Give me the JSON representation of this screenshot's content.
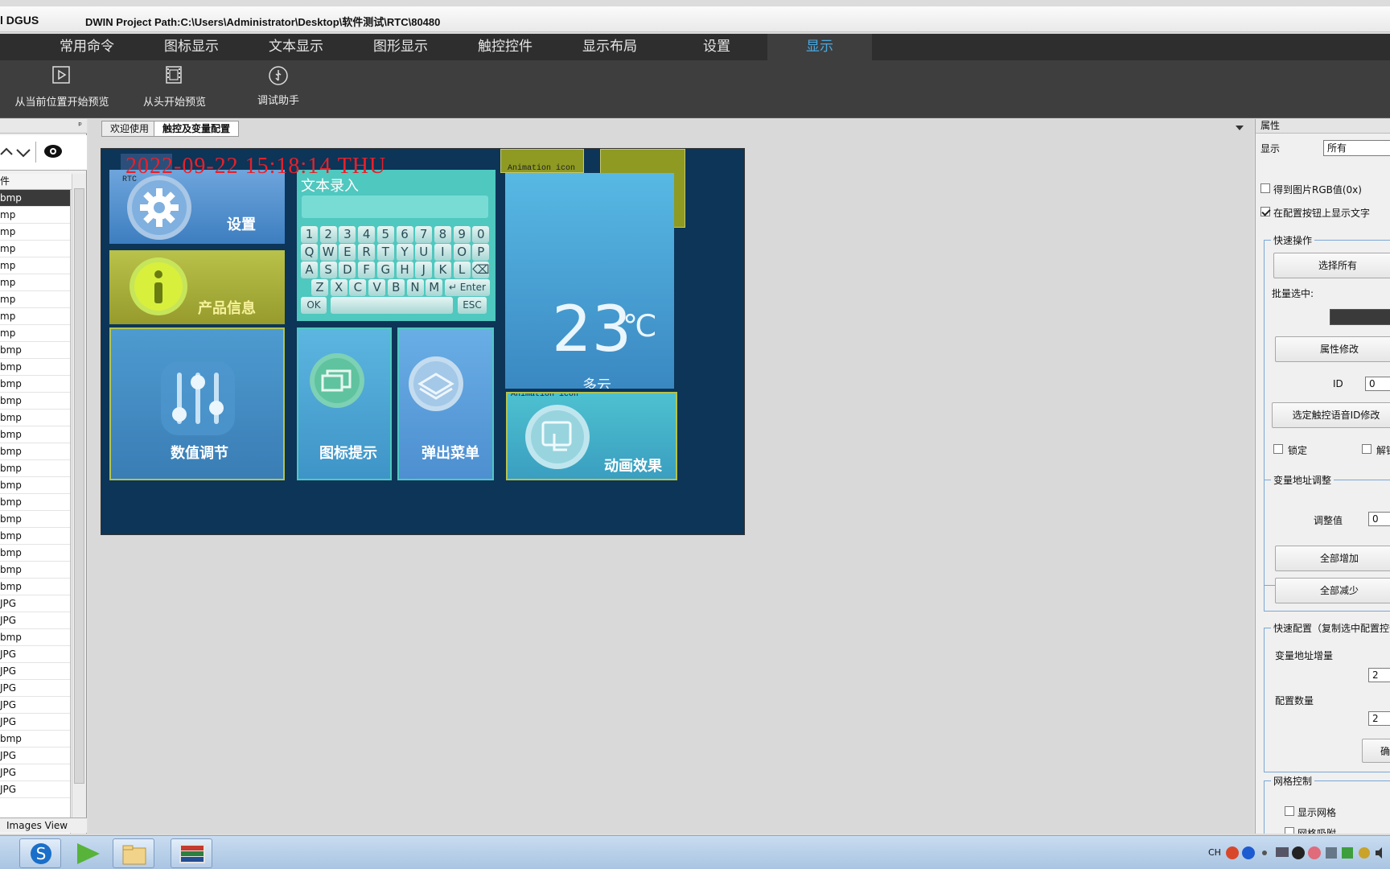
{
  "titlebar": {
    "app": "l DGUS",
    "path": "DWIN Project Path:C:\\Users\\Administrator\\Desktop\\软件测试\\RTC\\80480"
  },
  "menu": {
    "items": [
      "常用命令",
      "图标显示",
      "文本显示",
      "图形显示",
      "触控控件",
      "显示布局",
      "设置",
      "显示"
    ],
    "active": "显示"
  },
  "ribbon": {
    "buttons": [
      "从当前位置开始预览",
      "从头开始预览",
      "调试助手"
    ]
  },
  "left_panel": {
    "pin_glyph": "ᵖ",
    "column_header": "件",
    "files": [
      "bmp",
      "mp",
      "mp",
      "mp",
      "mp",
      "mp",
      "mp",
      "mp",
      "mp",
      "bmp",
      "bmp",
      "bmp",
      "bmp",
      "bmp",
      "bmp",
      "bmp",
      "bmp",
      "bmp",
      "bmp",
      "bmp",
      "bmp",
      "bmp",
      "bmp",
      "bmp",
      "JPG",
      "JPG",
      "bmp",
      "JPG",
      "JPG",
      "JPG",
      "JPG",
      "JPG",
      "bmp",
      "JPG",
      "JPG",
      "JPG"
    ],
    "bottom_tab": "Images View"
  },
  "tabs": [
    "欢迎使用",
    "触控及变量配置"
  ],
  "active_tab": "触控及变量配置",
  "screen": {
    "datetime": "2022-09-22 15:18:14 THU",
    "rtc_label": "RTC",
    "settings_label": "设置",
    "product_info_label": "产品信息",
    "value_adjust_label": "数值调节",
    "icon_hint_label": "图标提示",
    "popup_menu_label": "弹出菜单",
    "animation_label": "动画效果",
    "text_entry_title": "文本录入",
    "animation_icon_label": "Animation icon",
    "animation_icon_label_2": "Animation icon",
    "temperature": "23",
    "temp_unit": "℃",
    "weather": "多云",
    "keyboard": {
      "row1": [
        "1",
        "2",
        "3",
        "4",
        "5",
        "6",
        "7",
        "8",
        "9",
        "0"
      ],
      "row2": [
        "Q",
        "W",
        "E",
        "R",
        "T",
        "Y",
        "U",
        "I",
        "O",
        "P"
      ],
      "row3": [
        "A",
        "S",
        "D",
        "F",
        "G",
        "H",
        "J",
        "K",
        "L",
        "⌫"
      ],
      "row4": [
        "Z",
        "X",
        "C",
        "V",
        "B",
        "N",
        "M",
        "↵ Enter"
      ],
      "ok": "OK",
      "esc": "ESC"
    }
  },
  "properties": {
    "title": "属性",
    "display_label": "显示",
    "display_value": "所有",
    "cb_rgb": "得到图片RGB值(0x)",
    "cb_show_text": "在配置按钮上显示文字",
    "group_quick_ops": "快速操作",
    "btn_select_all": "选择所有",
    "batch_select": "批量选中:",
    "btn_modify_attr": "属性修改",
    "id_label": "ID",
    "id_value": "0",
    "btn_touch_voice": "选定触控语音ID修改",
    "cb_lock": "锁定",
    "cb_unlock": "解锁",
    "group_var_addr": "变量地址调整",
    "adjust_label": "调整值",
    "adjust_value": "0",
    "btn_all_inc": "全部增加",
    "btn_all_dec": "全部减少",
    "group_quick_cfg": "快速配置（复制选中配置控件）",
    "var_addr_inc_label": "变量地址增量",
    "var_addr_inc_value": "2",
    "cfg_count_label": "配置数量",
    "cfg_count_value": "2",
    "btn_confirm": "确定",
    "group_grid": "网格控制",
    "cb_show_grid": "显示网格",
    "cb_grid_snap": "网格吸附"
  },
  "taskbar": {
    "tray_text": "CH"
  }
}
